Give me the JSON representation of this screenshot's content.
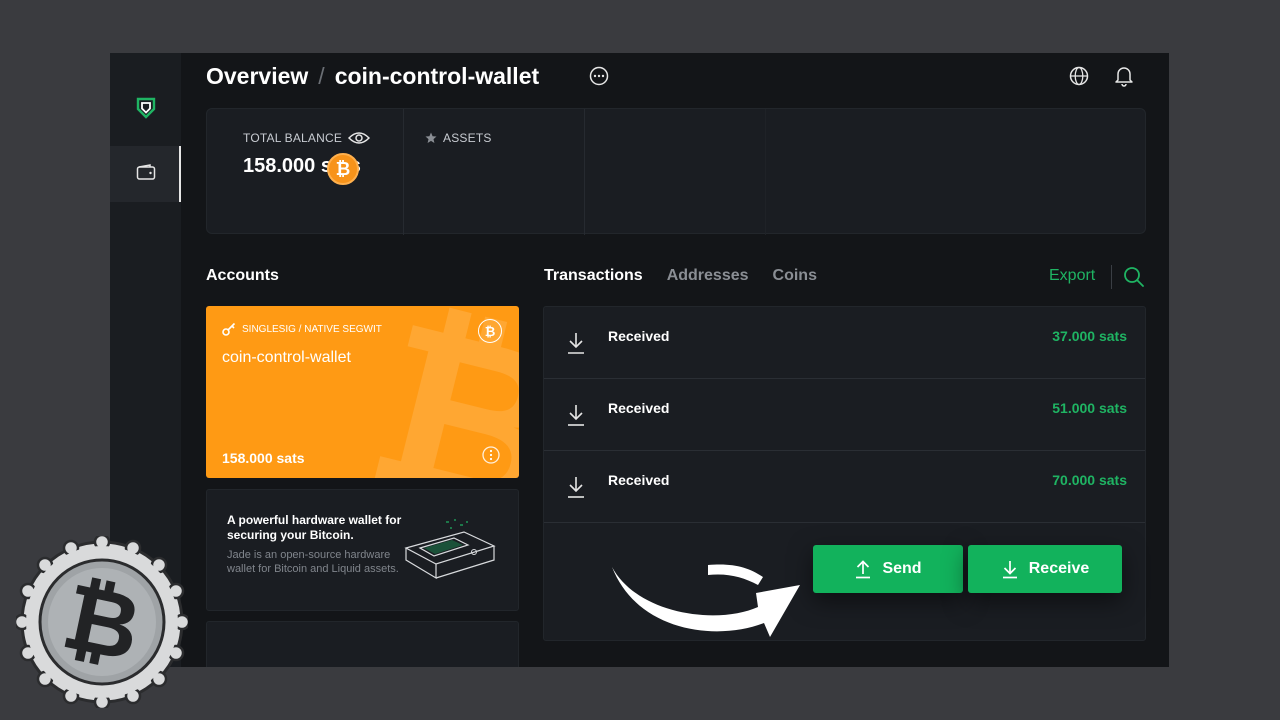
{
  "header": {
    "section": "Overview",
    "separator": "/",
    "wallet_name": "coin-control-wallet"
  },
  "sidebar": {
    "items": [
      {
        "name": "logo",
        "icon": "shield-logo-icon"
      },
      {
        "name": "wallet",
        "icon": "wallet-icon",
        "active": true
      }
    ]
  },
  "summary": {
    "total_balance_label": "TOTAL BALANCE",
    "total_balance_value": "158.000 sats",
    "assets_label": "ASSETS",
    "asset_symbol": "₿"
  },
  "accounts": {
    "title": "Accounts",
    "card": {
      "type": "SINGLESIG / NATIVE SEGWIT",
      "name": "coin-control-wallet",
      "balance": "158.000 sats",
      "symbol": "₿",
      "color": "#ff9a14"
    },
    "promo": {
      "title": "A powerful hardware wallet for securing your Bitcoin.",
      "description": "Jade is an open-source hardware wallet for Bitcoin and Liquid assets."
    }
  },
  "transactions": {
    "tabs": [
      "Transactions",
      "Addresses",
      "Coins"
    ],
    "active_tab": "Transactions",
    "export_label": "Export",
    "rows": [
      {
        "label": "Received",
        "amount": "37.000 sats"
      },
      {
        "label": "Received",
        "amount": "51.000 sats"
      },
      {
        "label": "Received",
        "amount": "70.000 sats"
      }
    ]
  },
  "actions": {
    "send_label": "Send",
    "receive_label": "Receive"
  },
  "colors": {
    "accent_green": "#12b25c",
    "amount_green": "#1fb463",
    "bitcoin_orange": "#f7931a",
    "background": "#131518"
  }
}
